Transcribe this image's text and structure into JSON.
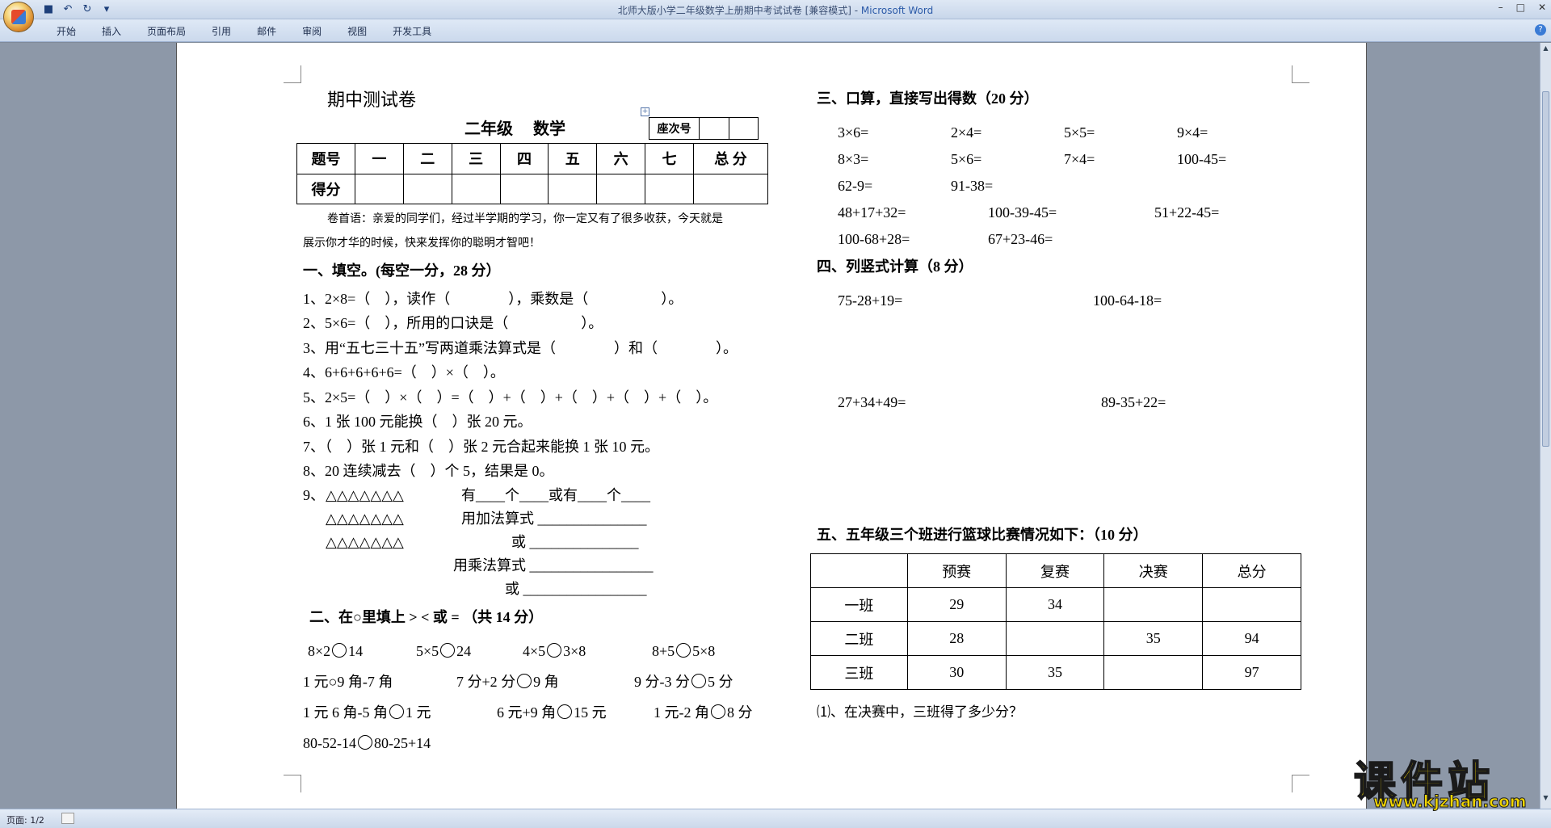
{
  "window": {
    "title": "北师大版小学二年级数学上册期中考试试卷 [兼容模式] - ",
    "app_name": "Microsoft Word",
    "controls": [
      "–",
      "□",
      "✕"
    ]
  },
  "quick_access": [
    "save-icon",
    "undo-icon",
    "redo-icon",
    "customize-icon"
  ],
  "ribbon": {
    "tabs": [
      "开始",
      "插入",
      "页面布局",
      "引用",
      "邮件",
      "审阅",
      "视图",
      "开发工具"
    ]
  },
  "status": {
    "page": "页面: 1/2"
  },
  "doc": {
    "title": "期中测试卷",
    "subtitle": "二年级　 数学",
    "seat_label": "座次号",
    "grade_table": {
      "row1": [
        "题号",
        "一",
        "二",
        "三",
        "四",
        "五",
        "六",
        "七",
        "总 分"
      ],
      "row2_label": "得分"
    },
    "intro_line1": "卷首语：亲爱的同学们，经过半学期的学习，你一定又有了很多收获，今天就是",
    "intro_line2": "展示你才华的时候，快来发挥你的聪明才智吧！",
    "s1_title": "一、填空。(每空一分，28 分）",
    "s1_items": [
      "1、2×8=（　），读作（　　　　），乘数是（　　　　　）。",
      "2、5×6=（　），所用的口诀是（　　　　　）。",
      "3、用“五七三十五”写两道乘法算式是（　　　　）和（　　　　）。",
      "4、6+6+6+6+6=（　）×（　）。",
      "5、2×5=（　）×（　）=（　）+（　）+（　）+（　）+（　）。",
      "6、1 张 100 元能换（　）张 20 元。",
      "7、（　）张 1 元和（　）张 2 元合起来能换 1 张 10 元。",
      "8、20 连续减去（　）个 5，结果是 0。"
    ],
    "q9": {
      "num": "9、",
      "triangles": "△△△△△△△",
      "line1": "有____个____或有____个____",
      "line2": "用加法算式 _______________",
      "line3": "或 _______________",
      "line4": "用乘法算式 _________________",
      "line5": "或 _________________"
    },
    "s2_title": "二、在○里填上 > < 或 = （共 14 分）",
    "s2_rows": [
      [
        [
          "8×2",
          "14"
        ],
        [
          "5×5",
          "24"
        ],
        [
          "4×5",
          "3×8"
        ],
        [
          "8+5",
          "5×8"
        ]
      ],
      [
        [
          "1 元○9 角-7 角",
          ""
        ],
        [
          "7 分+2 分",
          "9 角"
        ],
        [
          "9 分-3 分",
          "5 分"
        ]
      ],
      [
        [
          "1 元 6 角-5 角",
          "1 元"
        ],
        [
          "6 元+9 角",
          "15 元"
        ],
        [
          "1 元-2 角",
          "8 分"
        ]
      ],
      [
        [
          "80-52-14",
          "80-25+14"
        ]
      ]
    ],
    "s3_title": "三、口算，直接写出得数（20 分）",
    "s3_rows": [
      [
        "3×6=",
        "2×4=",
        "5×5=",
        "9×4="
      ],
      [
        "8×3=",
        "5×6=",
        "7×4=",
        "100-45="
      ],
      [
        "62-9=",
        "91-38="
      ],
      [
        "48+17+32=",
        "100-39-45=",
        "51+22-45="
      ],
      [
        "100-68+28=",
        "67+23-46="
      ]
    ],
    "s4_title": "四、列竖式计算（8 分）",
    "s4_items": [
      "75-28+19=",
      "100-64-18=",
      "27+34+49=",
      "89-35+22="
    ],
    "s5_title": "五、五年级三个班进行篮球比赛情况如下：（10 分）",
    "s5_table": {
      "headers": [
        "",
        "预赛",
        "复赛",
        "决赛",
        "总分"
      ],
      "rows": [
        [
          "一班",
          "29",
          "34",
          "",
          ""
        ],
        [
          "二班",
          "28",
          "",
          "35",
          "94"
        ],
        [
          "三班",
          "30",
          "35",
          "",
          "97"
        ]
      ]
    },
    "s5_q1": "⑴、在决赛中，三班得了多少分？"
  },
  "watermark": {
    "text": "课件站",
    "url": "www.kjzhan.com"
  }
}
